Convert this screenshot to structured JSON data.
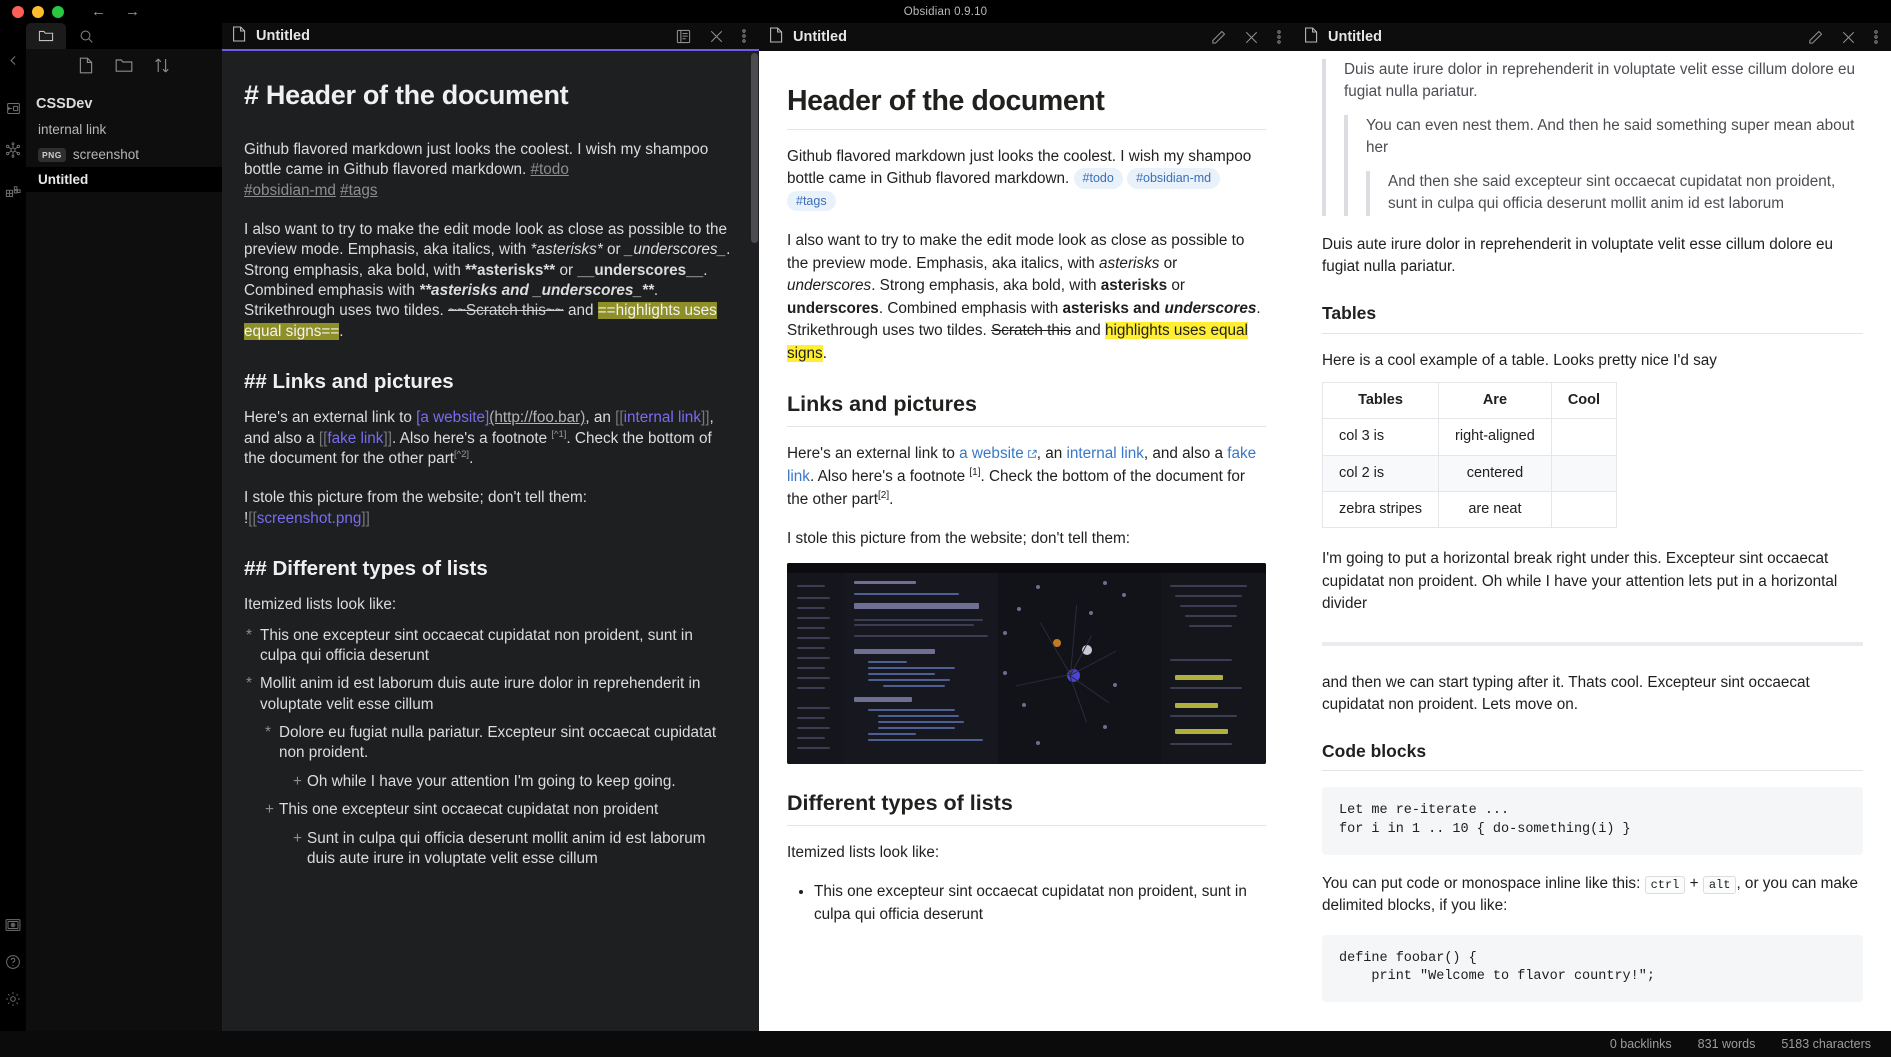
{
  "window": {
    "title": "Obsidian 0.9.10"
  },
  "titlebar": {
    "back_icon": "←",
    "forward_icon": "→"
  },
  "ribbon": {
    "items": [
      {
        "name": "collapse-left-sidebar",
        "icon": "chevron-left-icon"
      },
      {
        "name": "open-note-composer",
        "icon": "note-composer-icon"
      },
      {
        "name": "open-graph-view",
        "icon": "graph-icon"
      },
      {
        "name": "open-canvas",
        "icon": "canvas-icon"
      }
    ],
    "bottom_items": [
      {
        "name": "open-another-vault",
        "icon": "vault-icon"
      },
      {
        "name": "help",
        "icon": "question-circle-icon"
      },
      {
        "name": "settings",
        "icon": "gear-icon"
      }
    ]
  },
  "explorer": {
    "tabs": [
      {
        "label": "Files",
        "icon": "folder-icon",
        "active": true
      },
      {
        "label": "Search",
        "icon": "search-icon",
        "active": false
      }
    ],
    "toolbar": [
      {
        "label": "New note",
        "icon": "new-note-icon"
      },
      {
        "label": "New folder",
        "icon": "new-folder-icon"
      },
      {
        "label": "Change sort order",
        "icon": "sort-icon"
      }
    ],
    "items": [
      {
        "label": "CSSDev",
        "type": "folder",
        "active": false,
        "badge": ""
      },
      {
        "label": "internal link",
        "type": "file",
        "active": false,
        "badge": ""
      },
      {
        "label": "screenshot",
        "type": "file",
        "active": false,
        "badge": "PNG"
      },
      {
        "label": "Untitled",
        "type": "file",
        "active": true,
        "badge": ""
      }
    ]
  },
  "panes": [
    {
      "title": "Untitled",
      "file_icon": "document-icon",
      "mode": "source",
      "actions": [
        {
          "name": "preview-mode",
          "icon": "reading-view-icon"
        },
        {
          "name": "close-pane",
          "icon": "close-icon"
        },
        {
          "name": "more-options",
          "icon": "vertical-dots-icon"
        }
      ]
    },
    {
      "title": "Untitled",
      "file_icon": "document-icon",
      "mode": "preview",
      "actions": [
        {
          "name": "edit-mode",
          "icon": "pencil-icon"
        },
        {
          "name": "close-pane",
          "icon": "close-icon"
        },
        {
          "name": "more-options",
          "icon": "vertical-dots-icon"
        }
      ]
    },
    {
      "title": "Untitled",
      "file_icon": "document-icon",
      "mode": "preview",
      "actions": [
        {
          "name": "edit-mode",
          "icon": "pencil-icon"
        },
        {
          "name": "close-pane",
          "icon": "close-icon"
        },
        {
          "name": "more-options",
          "icon": "vertical-dots-icon"
        }
      ]
    }
  ],
  "source_doc": {
    "h1": "# Header of the document",
    "p1_a": "Github flavored markdown just looks the coolest. I wish my shampoo bottle came in Github flavored markdown. ",
    "p1_tag1": "#todo",
    "p1_tag2": "#obsidian-md",
    "p1_tag3": "#tags",
    "p2_a": "I also want to try to make the edit mode look as close as possible to the preview mode. Emphasis, aka italics, with ",
    "p2_ital1": "*asterisks*",
    "p2_b": " or ",
    "p2_ital2": "_underscores_",
    "p2_c": ". Strong emphasis, aka bold, with ",
    "p2_bold1": "**asterisks**",
    "p2_d": " or ",
    "p2_bold2": "__underscores__",
    "p2_e": ". Combined emphasis with ",
    "p2_combo": "**asterisks and _underscores_**",
    "p2_f": ". Strikethrough uses two tildes. ",
    "p2_strike": "~~Scratch this~~",
    "p2_g": " and ",
    "p2_hl": "==highlights uses equal signs==",
    "p2_h": ".",
    "h2_links": "## Links and pictures",
    "p3_a": "Here's an external link to ",
    "p3_linktext": "[a website]",
    "p3_url": "(http://foo.bar)",
    "p3_b": ", an ",
    "p3_internal_open": "[[",
    "p3_internal": "internal link",
    "p3_internal_close": "]]",
    "p3_c": ", and also a ",
    "p3_fake_open": "[[",
    "p3_fake": "fake link",
    "p3_fake_close": "]]",
    "p3_d": ". Also here's a footnote ",
    "p3_fn1": "[^1]",
    "p3_e": ". Check the bottom of the document for the other part",
    "p3_fn2": "[^2]",
    "p3_f": ".",
    "p4_a": "I stole this picture from the website; don't tell them:",
    "p4_embed_bang": "!",
    "p4_embed_open": "[[",
    "p4_embed": "screenshot.png",
    "p4_embed_close": "]]",
    "h2_lists": "## Different types of lists",
    "p5": "Itemized lists look like:",
    "list": [
      {
        "bullet": "*",
        "level": 1,
        "text": "This one excepteur sint occaecat cupidatat non proident, sunt in culpa qui officia deserunt"
      },
      {
        "bullet": "*",
        "level": 1,
        "text": "Mollit anim id est laborum duis aute irure dolor in reprehenderit in voluptate velit esse cillum"
      },
      {
        "bullet": "*",
        "level": 2,
        "text": "Dolore eu fugiat nulla pariatur. Excepteur sint occaecat cupidatat non proident."
      },
      {
        "bullet": "+",
        "level": 3,
        "text": "Oh while I have your attention I'm going to keep going."
      },
      {
        "bullet": "+",
        "level": 2,
        "text": "This one excepteur sint occaecat cupidatat non proident"
      },
      {
        "bullet": "+",
        "level": 3,
        "text": "Sunt in culpa qui officia deserunt mollit anim id est laborum duis aute irure in voluptate velit esse cillum"
      }
    ]
  },
  "preview_doc": {
    "h1": "Header of the document",
    "p1_a": "Github flavored markdown just looks the coolest. I wish my shampoo bottle came in Github flavored markdown.",
    "tags": [
      "#todo",
      "#obsidian-md",
      "#tags"
    ],
    "p2_a": "I also want to try to make the edit mode look as close as possible to the preview mode. Emphasis, aka italics, with ",
    "p2_ital1": "asterisks",
    "p2_b": " or ",
    "p2_ital2": "underscores",
    "p2_c": ". Strong emphasis, aka bold, with ",
    "p2_bold1": "asterisks",
    "p2_d": " or ",
    "p2_bold2": "underscores",
    "p2_e": ". Combined emphasis with ",
    "p2_combo_bold": "asterisks and ",
    "p2_combo_ital": "underscores",
    "p2_f": ". Strikethrough uses two tildes. ",
    "p2_strike": "Scratch this",
    "p2_g": " and ",
    "p2_hl": "highlights uses equal signs",
    "p2_h": ".",
    "h2_links": "Links and pictures",
    "p3_a": "Here's an external link to ",
    "p3_website": "a website",
    "p3_b": ", an ",
    "p3_internal": "internal link",
    "p3_c": ", and also a ",
    "p3_fake": "fake link",
    "p3_d": ". Also here's a footnote ",
    "p3_fn1": "[1]",
    "p3_e": ". Check the bottom of the document for the other part",
    "p3_fn2": "[2]",
    "p3_f": ".",
    "p4": "I stole this picture from the website; don't tell them:",
    "image_alt": "screenshot.png",
    "h2_lists": "Different types of lists",
    "p5": "Itemized lists look like:",
    "list": [
      "This one excepteur sint occaecat cupidatat non proident, sunt in culpa qui officia deserunt"
    ]
  },
  "preview_doc_2": {
    "quote_l1": "Duis aute irure dolor in reprehenderit in voluptate velit esse cillum dolore eu fugiat nulla pariatur.",
    "quote_l2": "You can even nest them. And then he said something super mean about her",
    "quote_l3": "And then she said excepteur sint occaecat cupidatat non proident, sunt in culpa qui officia deserunt mollit anim id est laborum",
    "p_after_quote": "Duis aute irure dolor in reprehenderit in voluptate velit esse cillum dolore eu fugiat nulla pariatur.",
    "h2_tables": "Tables",
    "p_tables": "Here is a cool example of a table. Looks pretty nice I'd say",
    "table": {
      "headers": [
        "Tables",
        "Are",
        "Cool"
      ],
      "rows": [
        [
          "col 3 is",
          "right-aligned",
          ""
        ],
        [
          "col 2 is",
          "centered",
          ""
        ],
        [
          "zebra stripes",
          "are neat",
          ""
        ]
      ]
    },
    "p_hr": "I'm going to put a horizontal break right under this. Excepteur sint occaecat cupidatat non proident. Oh while I have your attention lets put in a horizontal divider",
    "p_after_hr": "and then we can start typing after it. Thats cool. Excepteur sint occaecat cupidatat non proident. Lets move on.",
    "h2_code": "Code blocks",
    "code1": "Let me re-iterate ...\nfor i in 1 .. 10 { do-something(i) }",
    "p_inline_a": "You can put code or monospace inline like this: ",
    "p_inline_code1": "ctrl",
    "p_inline_plus": " + ",
    "p_inline_code2": "alt",
    "p_inline_b": ", or you can make delimited blocks, if you like:",
    "code2": "define foobar() {\n    print \"Welcome to flavor country!\";"
  },
  "statusbar": {
    "backlinks": "0 backlinks",
    "words": "831 words",
    "characters": "5183 characters"
  }
}
